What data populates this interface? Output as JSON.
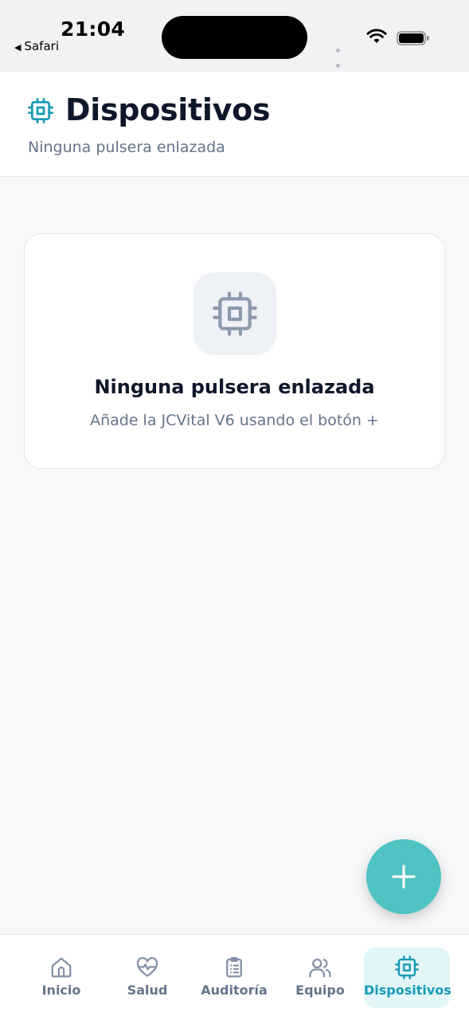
{
  "status_bar": {
    "time": "21:04",
    "back_app": "Safari"
  },
  "header": {
    "title": "Dispositivos",
    "subtitle": "Ninguna pulsera enlazada",
    "icon": "chip-icon"
  },
  "empty_state": {
    "icon": "chip-icon",
    "title": "Ninguna pulsera enlazada",
    "description": "Añade la JCVital V6 usando el botón +"
  },
  "fab": {
    "icon": "plus-icon"
  },
  "tabbar": {
    "active": "Dispositivos",
    "tabs": [
      {
        "label": "Inicio",
        "icon": "home-icon"
      },
      {
        "label": "Salud",
        "icon": "heart-pulse-icon"
      },
      {
        "label": "Auditoría",
        "icon": "clipboard-list-icon"
      },
      {
        "label": "Equipo",
        "icon": "users-icon"
      },
      {
        "label": "Dispositivos",
        "icon": "chip-icon"
      }
    ]
  },
  "colors": {
    "accent": "#1599b6",
    "fab": "#4fc3c3",
    "active_tab_bg": "#e3f6f7",
    "title": "#0f172a",
    "muted": "#64748b",
    "background": "#f7f8fa"
  }
}
